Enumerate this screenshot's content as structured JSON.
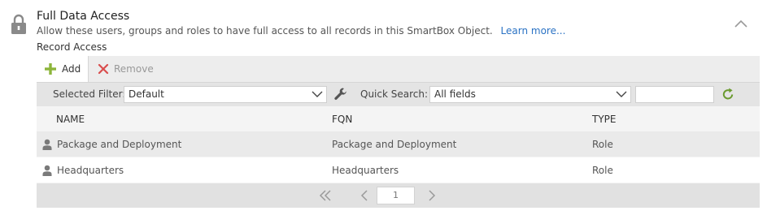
{
  "section": {
    "title": "Full Data Access",
    "description": "Allow these users, groups and roles to have full access to all records in this SmartBox Object.",
    "learn_more": "Learn more...",
    "subsection": "Record Access",
    "icon": "lock-icon"
  },
  "toolbar": {
    "add_label": "Add",
    "remove_label": "Remove"
  },
  "filter": {
    "selected_filter_label": "Selected Filter:",
    "selected_filter_value": "Default",
    "quick_search_label": "Quick Search:",
    "quick_search_field": "All fields",
    "quick_search_value": ""
  },
  "table": {
    "columns": [
      "NAME",
      "FQN",
      "TYPE"
    ],
    "rows": [
      {
        "name": "Package and Deployment",
        "fqn": "Package and Deployment",
        "type": "Role"
      },
      {
        "name": "Headquarters",
        "fqn": "Headquarters",
        "type": "Role"
      }
    ]
  },
  "pager": {
    "page": "1"
  },
  "colors": {
    "accent_link": "#2a72c4",
    "add_icon": "#8db53b",
    "remove_icon": "#d94d4d",
    "refresh_icon": "#6a9a2f"
  }
}
